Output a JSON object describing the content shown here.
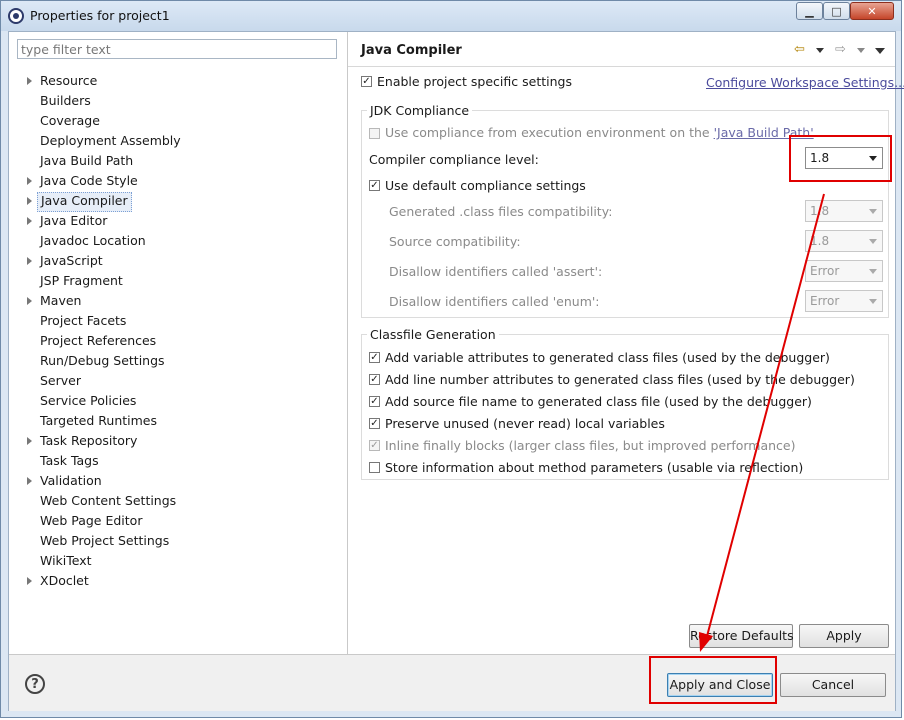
{
  "window": {
    "title": "Properties for project1",
    "controls": [
      "▁",
      "□",
      "✕"
    ]
  },
  "filter": {
    "placeholder": "type filter text"
  },
  "tree": [
    {
      "label": "Resource",
      "expandable": true
    },
    {
      "label": "Builders",
      "expandable": false
    },
    {
      "label": "Coverage",
      "expandable": false
    },
    {
      "label": "Deployment Assembly",
      "expandable": false
    },
    {
      "label": "Java Build Path",
      "expandable": false
    },
    {
      "label": "Java Code Style",
      "expandable": true
    },
    {
      "label": "Java Compiler",
      "expandable": true,
      "selected": true
    },
    {
      "label": "Java Editor",
      "expandable": true
    },
    {
      "label": "Javadoc Location",
      "expandable": false
    },
    {
      "label": "JavaScript",
      "expandable": true
    },
    {
      "label": "JSP Fragment",
      "expandable": false
    },
    {
      "label": "Maven",
      "expandable": true
    },
    {
      "label": "Project Facets",
      "expandable": false
    },
    {
      "label": "Project References",
      "expandable": false
    },
    {
      "label": "Run/Debug Settings",
      "expandable": false
    },
    {
      "label": "Server",
      "expandable": false
    },
    {
      "label": "Service Policies",
      "expandable": false
    },
    {
      "label": "Targeted Runtimes",
      "expandable": false
    },
    {
      "label": "Task Repository",
      "expandable": true
    },
    {
      "label": "Task Tags",
      "expandable": false
    },
    {
      "label": "Validation",
      "expandable": true
    },
    {
      "label": "Web Content Settings",
      "expandable": false
    },
    {
      "label": "Web Page Editor",
      "expandable": false
    },
    {
      "label": "Web Project Settings",
      "expandable": false
    },
    {
      "label": "WikiText",
      "expandable": false
    },
    {
      "label": "XDoclet",
      "expandable": true
    }
  ],
  "page": {
    "title": "Java Compiler",
    "nav_icons": [
      "back-arrow-icon",
      "forward-arrow-icon",
      "view-menu-icon"
    ],
    "enable_specific": {
      "label": "Enable project specific settings",
      "checked": true
    },
    "configure_link": "Configure Workspace Settings...",
    "jdk": {
      "title": "JDK Compliance",
      "use_env": {
        "label_prefix": "Use compliance from execution environment on the ",
        "label_link": "'Java Build Path'",
        "checked": false
      },
      "level_label": "Compiler compliance level:",
      "level_value": "1.8",
      "use_default": {
        "label": "Use default compliance settings",
        "checked": true
      },
      "rows": [
        {
          "label": "Generated .class files compatibility:",
          "value": "1.8"
        },
        {
          "label": "Source compatibility:",
          "value": "1.8"
        },
        {
          "label": "Disallow identifiers called 'assert':",
          "value": "Error"
        },
        {
          "label": "Disallow identifiers called 'enum':",
          "value": "Error"
        }
      ]
    },
    "classfile": {
      "title": "Classfile Generation",
      "options": [
        {
          "label": "Add variable attributes to generated class files (used by the debugger)",
          "checked": true,
          "disabled": false
        },
        {
          "label": "Add line number attributes to generated class files (used by the debugger)",
          "checked": true,
          "disabled": false
        },
        {
          "label": "Add source file name to generated class file (used by the debugger)",
          "checked": true,
          "disabled": false
        },
        {
          "label": "Preserve unused (never read) local variables",
          "checked": true,
          "disabled": false
        },
        {
          "label": "Inline finally blocks (larger class files, but improved performance)",
          "checked": true,
          "disabled": true
        },
        {
          "label": "Store information about method parameters (usable via reflection)",
          "checked": false,
          "disabled": false
        }
      ]
    },
    "restore_defaults": "Restore Defaults",
    "apply": "Apply"
  },
  "footer": {
    "help": "?",
    "apply_close": "Apply and Close",
    "cancel": "Cancel"
  },
  "colors": {
    "annotation": "#e00000",
    "selection": "#e7eef8",
    "link": "#4b4b9c"
  }
}
